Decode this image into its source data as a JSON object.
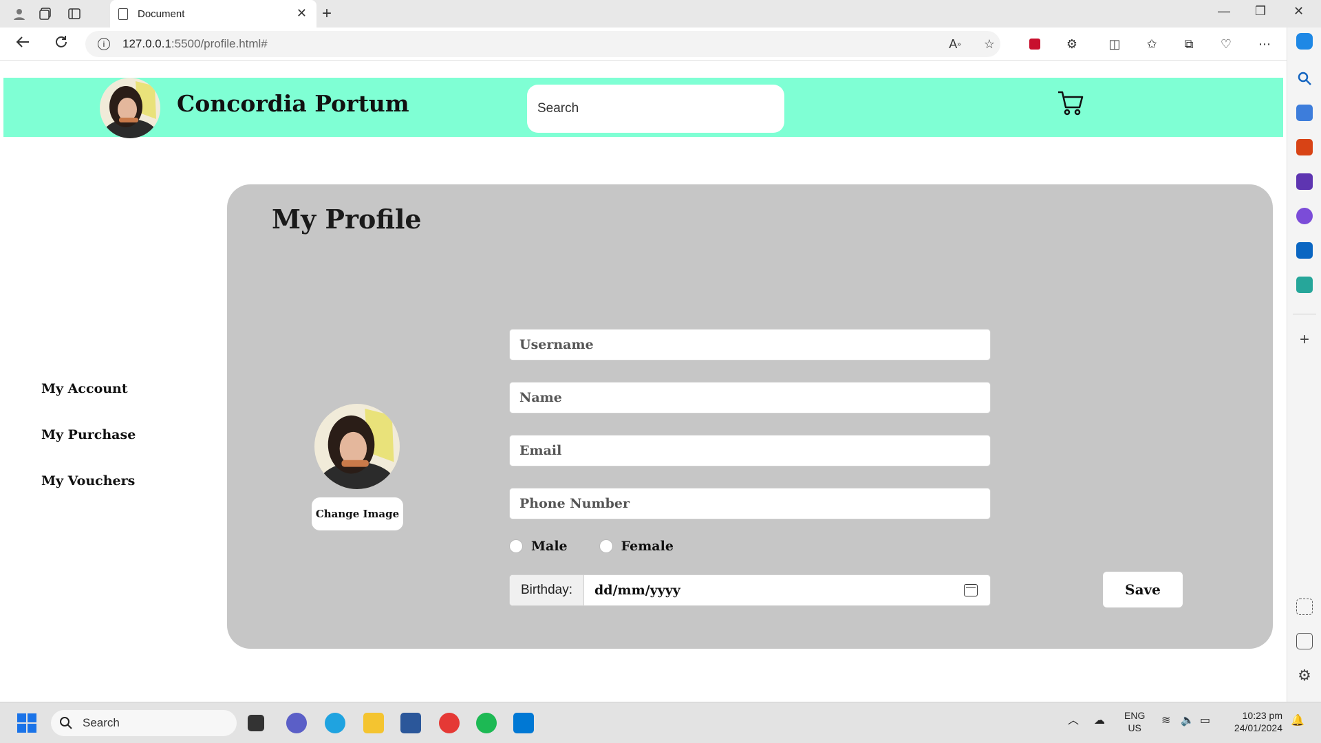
{
  "browser": {
    "tab_title": "Document",
    "url_host": "127.0.0.1",
    "url_path": ":5500/profile.html#"
  },
  "site": {
    "title": "Concordia Portum",
    "search_placeholder": "Search"
  },
  "menu": {
    "items": [
      {
        "label": "My Account"
      },
      {
        "label": "My Purchase"
      },
      {
        "label": "My Vouchers"
      }
    ]
  },
  "profile": {
    "heading": "My Profile",
    "change_image_label": "Change Image",
    "fields": {
      "username_placeholder": "Username",
      "name_placeholder": "Name",
      "email_placeholder": "Email",
      "phone_placeholder": "Phone Number"
    },
    "gender": {
      "male_label": "Male",
      "female_label": "Female"
    },
    "birthday": {
      "label": "Birthday:",
      "value": "dd/mm/yyyy"
    },
    "save_label": "Save"
  },
  "taskbar": {
    "search_label": "Search",
    "lang_line1": "ENG",
    "lang_line2": "US",
    "time": "10:23 pm",
    "date": "24/01/2024"
  },
  "colors": {
    "header_bg": "#7fffd4",
    "card_bg": "#c6c6c6"
  }
}
